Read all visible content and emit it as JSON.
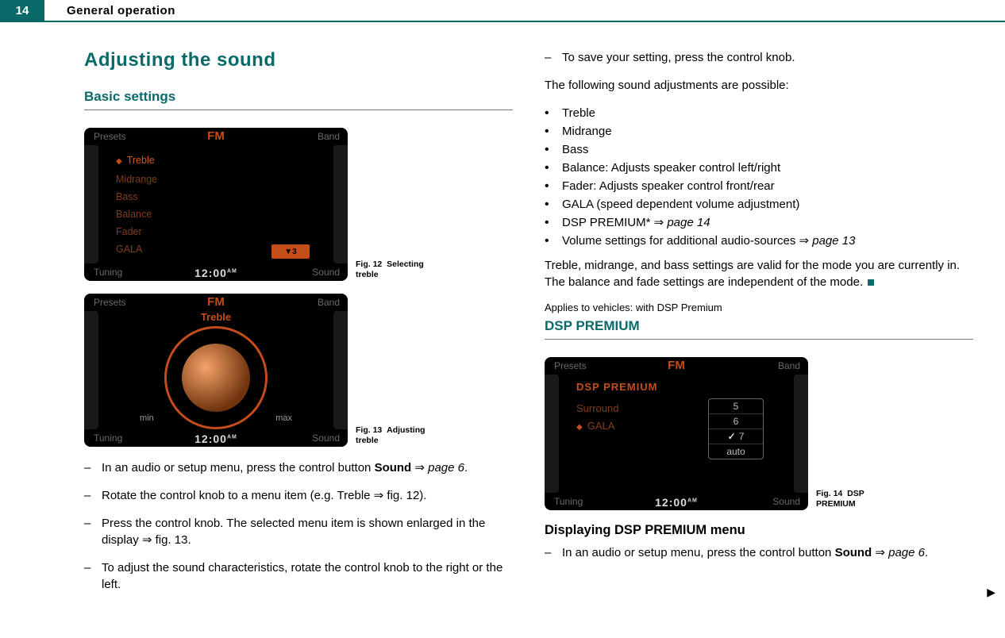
{
  "header": {
    "pageNumber": "14",
    "section": "General operation"
  },
  "left": {
    "h1": "Adjusting the sound",
    "h2": "Basic settings",
    "fig12": {
      "label": "Fig. 12",
      "caption": "Selecting treble"
    },
    "fig13": {
      "label": "Fig. 13",
      "caption": "Adjusting treble"
    },
    "screen": {
      "corners": {
        "topLeft": "Presets",
        "topRight": "Band",
        "botLeft": "Tuning",
        "botRight": "Sound"
      },
      "headerFM": "FM",
      "headerTreble": "Treble",
      "time": "12:00",
      "timeSuffix": "AM",
      "menu": {
        "items": [
          "Treble",
          "Midrange",
          "Bass",
          "Balance",
          "Fader",
          "GALA"
        ]
      },
      "v3": "▼3",
      "dialMin": "min",
      "dialMax": "max"
    },
    "steps": {
      "s1a": "In an audio or setup menu, press the control button ",
      "s1b": "Sound",
      "s1c": " ⇒ ",
      "s1d": "page 6",
      "s1e": ".",
      "s2a": "Rotate the control knob to a menu item (e.g. Treble ⇒ fig. 12).",
      "s3a": "Press the control knob. The selected menu item is shown enlarged in the display ⇒ fig. 13.",
      "s4a": "To adjust the sound characteristics, rotate the control knob to the right or the left."
    }
  },
  "right": {
    "stepSave": "To save your setting, press the control knob.",
    "intro": "The following sound adjustments are possible:",
    "bullets": {
      "b1": "Treble",
      "b2": "Midrange",
      "b3": "Bass",
      "b4": "Balance: Adjusts speaker control left/right",
      "b5": "Fader: Adjusts speaker control front/rear",
      "b6": "GALA (speed dependent volume adjustment)",
      "b7a": "DSP PREMIUM* ⇒ ",
      "b7b": "page 14",
      "b8a": "Volume settings for additional audio-sources ⇒ ",
      "b8b": "page 13"
    },
    "trail": "Treble, midrange, and bass settings are valid for the mode you are currently in. The balance and fade settings are independent of the mode.",
    "note": "Applies to vehicles: with DSP Premium",
    "h2": "DSP PREMIUM",
    "fig14": {
      "label": "Fig. 14",
      "caption": "DSP PREMIUM"
    },
    "dspScreen": {
      "title": "DSP PREMIUM",
      "items": [
        "Surround",
        "GALA"
      ],
      "popup": [
        "5",
        "6",
        "7",
        "auto"
      ]
    },
    "h3": "Displaying DSP PREMIUM menu",
    "step": {
      "a": "In an audio or setup menu, press the control button ",
      "b": "Sound",
      "c": " ⇒ ",
      "d": "page 6",
      "e": "."
    }
  }
}
